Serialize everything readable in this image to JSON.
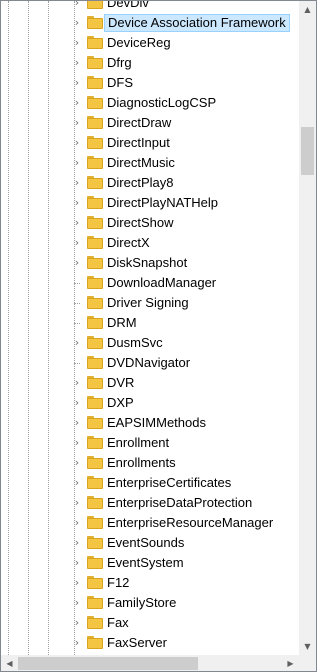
{
  "tree": {
    "items": [
      {
        "label": "DevDiv",
        "expandable": true,
        "selected": false
      },
      {
        "label": "Device Association Framework",
        "expandable": true,
        "selected": true
      },
      {
        "label": "DeviceReg",
        "expandable": true,
        "selected": false
      },
      {
        "label": "Dfrg",
        "expandable": true,
        "selected": false
      },
      {
        "label": "DFS",
        "expandable": true,
        "selected": false
      },
      {
        "label": "DiagnosticLogCSP",
        "expandable": true,
        "selected": false
      },
      {
        "label": "DirectDraw",
        "expandable": true,
        "selected": false
      },
      {
        "label": "DirectInput",
        "expandable": true,
        "selected": false
      },
      {
        "label": "DirectMusic",
        "expandable": true,
        "selected": false
      },
      {
        "label": "DirectPlay8",
        "expandable": true,
        "selected": false
      },
      {
        "label": "DirectPlayNATHelp",
        "expandable": true,
        "selected": false
      },
      {
        "label": "DirectShow",
        "expandable": true,
        "selected": false
      },
      {
        "label": "DirectX",
        "expandable": true,
        "selected": false
      },
      {
        "label": "DiskSnapshot",
        "expandable": true,
        "selected": false
      },
      {
        "label": "DownloadManager",
        "expandable": false,
        "selected": false
      },
      {
        "label": "Driver Signing",
        "expandable": false,
        "selected": false
      },
      {
        "label": "DRM",
        "expandable": false,
        "selected": false
      },
      {
        "label": "DusmSvc",
        "expandable": true,
        "selected": false
      },
      {
        "label": "DVDNavigator",
        "expandable": false,
        "selected": false
      },
      {
        "label": "DVR",
        "expandable": true,
        "selected": false
      },
      {
        "label": "DXP",
        "expandable": true,
        "selected": false
      },
      {
        "label": "EAPSIMMethods",
        "expandable": true,
        "selected": false
      },
      {
        "label": "Enrollment",
        "expandable": true,
        "selected": false
      },
      {
        "label": "Enrollments",
        "expandable": true,
        "selected": false
      },
      {
        "label": "EnterpriseCertificates",
        "expandable": true,
        "selected": false
      },
      {
        "label": "EnterpriseDataProtection",
        "expandable": true,
        "selected": false
      },
      {
        "label": "EnterpriseResourceManager",
        "expandable": true,
        "selected": false
      },
      {
        "label": "EventSounds",
        "expandable": true,
        "selected": false
      },
      {
        "label": "EventSystem",
        "expandable": true,
        "selected": false
      },
      {
        "label": "F12",
        "expandable": true,
        "selected": false
      },
      {
        "label": "FamilyStore",
        "expandable": true,
        "selected": false
      },
      {
        "label": "Fax",
        "expandable": true,
        "selected": false
      },
      {
        "label": "FaxServer",
        "expandable": true,
        "selected": false
      }
    ],
    "expand_icon": "chevron-right-icon",
    "item_icon": "folder-icon"
  },
  "scrollbars": {
    "vertical": {
      "up_icon": "▲",
      "down_icon": "▼"
    },
    "horizontal": {
      "left_icon": "◀",
      "right_icon": "▶"
    }
  },
  "colors": {
    "selection_fill": "#cce8ff",
    "selection_border": "#99d1ff",
    "folder": "#f4c542",
    "scrollbar_track": "#f0f0f0",
    "scrollbar_thumb": "#cdcdcd"
  }
}
